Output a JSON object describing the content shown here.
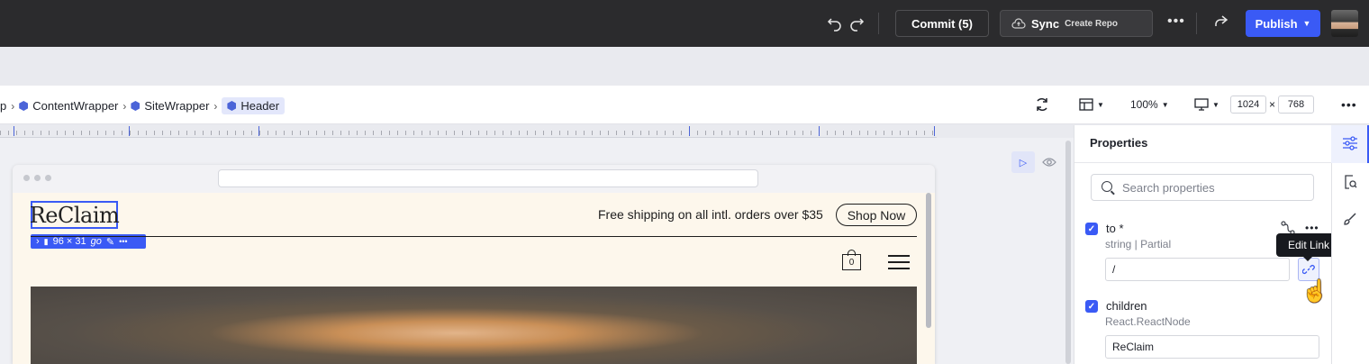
{
  "topbar": {
    "undo_icon": "undo-icon",
    "redo_icon": "redo-icon",
    "commit_label": "Commit (5)",
    "sync_label": "Sync",
    "sync_sub": "Create Repo",
    "more_icon": "more-horizontal-icon",
    "share_icon": "share-icon",
    "publish_label": "Publish"
  },
  "breadcrumb": {
    "items": [
      {
        "label": "p"
      },
      {
        "label": "ContentWrapper"
      },
      {
        "label": "SiteWrapper"
      },
      {
        "label": "Header"
      }
    ]
  },
  "toolbar": {
    "zoom": "100%",
    "width": "1024",
    "height": "768",
    "times": "×"
  },
  "canvas": {
    "logo_text": "ReClaim",
    "selection_size": "96 × 31",
    "selection_tag": "go",
    "announcement": "Free shipping on all intl. orders over $35",
    "shop_now": "Shop Now",
    "cart_count": "0"
  },
  "properties": {
    "title": "Properties",
    "search_placeholder": "Search properties",
    "props": [
      {
        "name": "to *",
        "type": "string | Partial",
        "value": "/"
      },
      {
        "name": "children",
        "type": "React.ReactNode",
        "value": "ReClaim"
      }
    ],
    "tooltip": "Edit Link"
  },
  "colors": {
    "accent": "#3a5af5",
    "topbar_bg": "#2b2b2d",
    "site_bg": "#fdf7ec"
  }
}
